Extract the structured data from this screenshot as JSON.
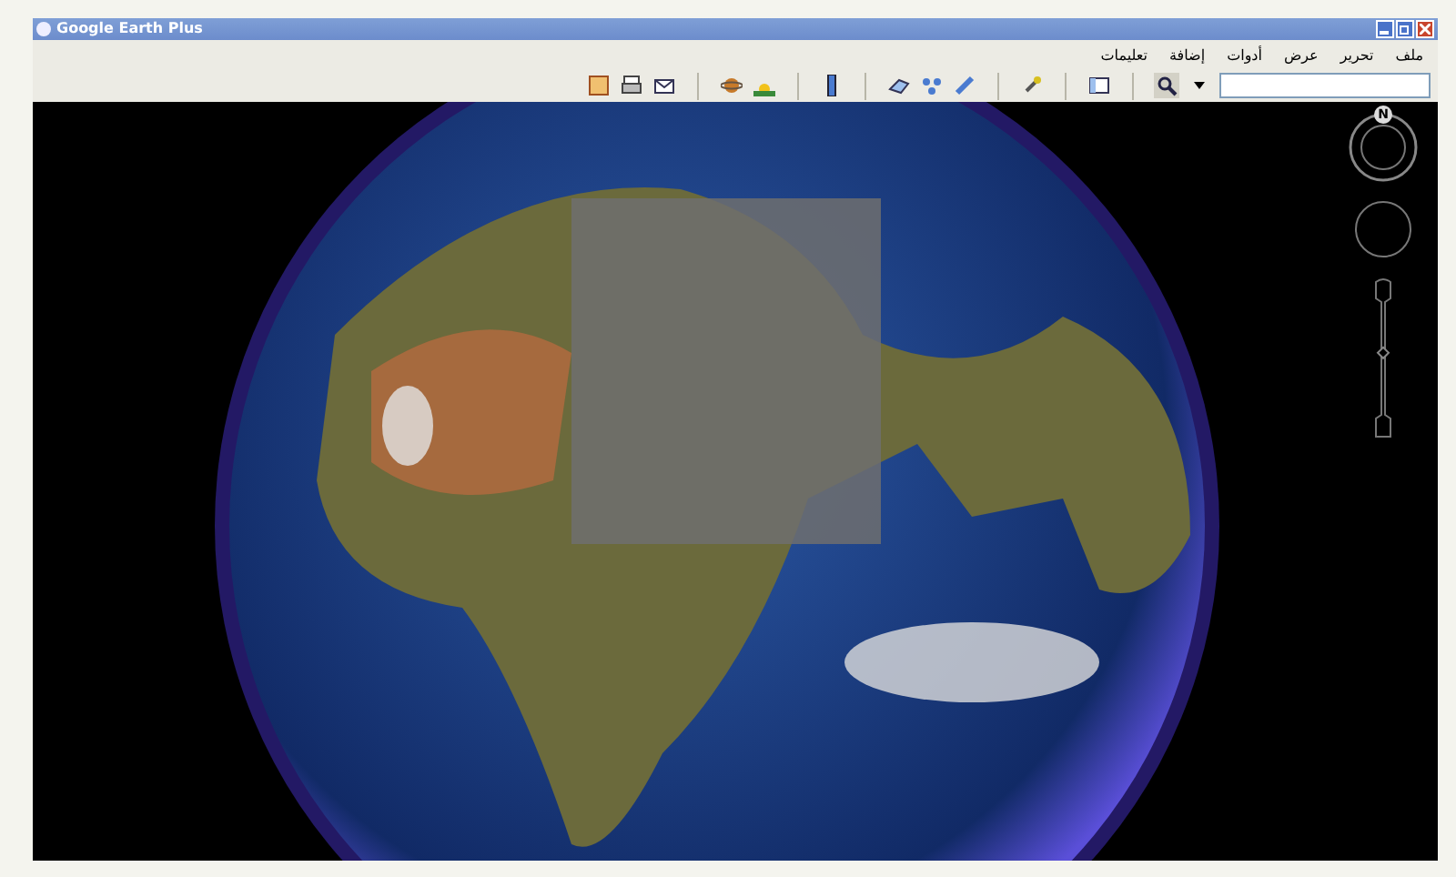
{
  "window": {
    "title": "Google Earth Plus"
  },
  "menu": [
    "ملف",
    "تحرير",
    "عرض",
    "أدوات",
    "إضافة",
    "تعليمات"
  ],
  "navigation": {
    "compass_label": "N",
    "zoom": {
      "level": 0.55
    }
  }
}
